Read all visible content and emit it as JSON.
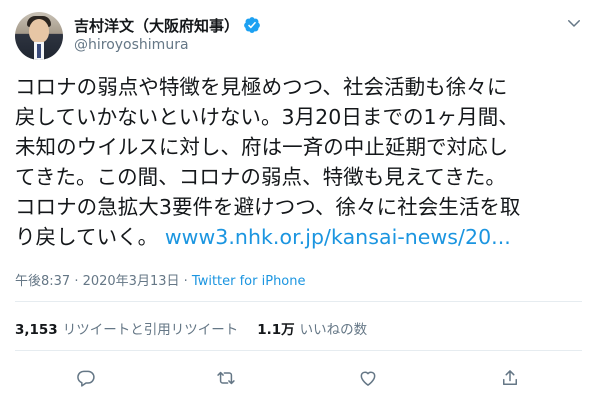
{
  "author": {
    "display_name": "吉村洋文（大阪府知事）",
    "handle": "@hiroyoshimura",
    "avatar_icon": "profile-photo",
    "verified_icon": "verified-badge-icon"
  },
  "tweet": {
    "text": "コロナの弱点や特徴を見極めつつ、社会活動も徐々に\n戻していかないといけない。3月20日までの1ヶ月間、\n未知のウイルスに対し、府は一斉の中止延期で対応し\nてきた。この間、コロナの弱点、特徴も見えてきた。\nコロナの急拡大3要件を避けつつ、徐々に社会生活を取\nり戻していく。 ",
    "link_text": "www3.nhk.or.jp/kansai-news/20..."
  },
  "meta": {
    "timestamp": "午後8:37 · 2020年3月13日",
    "separator": " · ",
    "source": "Twitter for iPhone"
  },
  "stats": {
    "retweets_count": "3,153",
    "retweets_label": "リツイートと引用リツイート",
    "likes_count": "1.1万",
    "likes_label": "いいねの数"
  },
  "actions": [
    {
      "name": "reply",
      "icon": "reply-icon"
    },
    {
      "name": "retweet",
      "icon": "retweet-icon"
    },
    {
      "name": "like",
      "icon": "heart-icon"
    },
    {
      "name": "share",
      "icon": "share-icon"
    }
  ],
  "colors": {
    "text": "#14171a",
    "secondary": "#657786",
    "link": "#1b95e0",
    "verified": "#1da1f2",
    "divider": "#e6ecf0"
  }
}
